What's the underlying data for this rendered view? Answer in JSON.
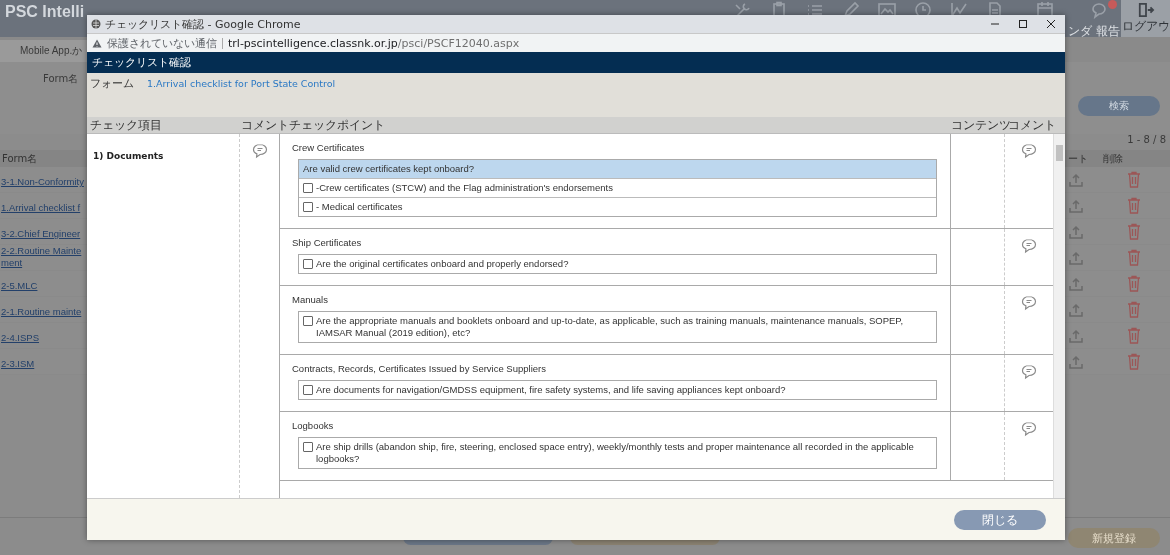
{
  "app_header": {
    "title": "PSC Intelli",
    "calendar_label": "ンダ",
    "report_label": "報告",
    "logout_label": "ログアウ"
  },
  "background_page": {
    "tab": "Mobile App.か",
    "form_label": "Form名",
    "search_button": "検索",
    "count": "1 - 8 / 8",
    "columns": [
      "Form名",
      "ート",
      "削除"
    ],
    "rows": [
      {
        "name": "3-1.Non-Conformity"
      },
      {
        "name": "1.Arrival checklist f"
      },
      {
        "name": "3-2.Chief Engineer"
      },
      {
        "name": "2-2.Routine Mainte\nment"
      },
      {
        "name": "2-5.MLC"
      },
      {
        "name": "2-1.Routine mainte"
      },
      {
        "name": "2-4.ISPS"
      },
      {
        "name": "2-3.ISM"
      }
    ],
    "new_button": "新規登録"
  },
  "browser_window": {
    "title": "チェックリスト確認 - Google Chrome",
    "security": "保護されていない通信",
    "url_host": "trl-pscintelligence.classnk.or.jp",
    "url_path": "/psci/PSCF12040.aspx"
  },
  "dialog": {
    "title": "チェックリスト確認",
    "form_label": "フォーム",
    "form_name": "1.Arrival checklist for Port State Control",
    "columns": [
      "チェック項目",
      "コメント",
      "チェックポイント",
      "コンテンツ",
      "コメント"
    ],
    "items": [
      {
        "label": "1) Documents",
        "sections": [
          {
            "title": "Crew Certificates",
            "points": [
              {
                "kind": "question",
                "text": "Are valid crew certificates kept onboard?"
              },
              {
                "kind": "check",
                "text": "-Crew certificates (STCW) and the Flag administration's endorsements",
                "checked": false
              },
              {
                "kind": "check",
                "text": "- Medical certificates",
                "checked": false
              }
            ]
          },
          {
            "title": "Ship Certificates",
            "points": [
              {
                "kind": "check",
                "text": "Are the original certificates onboard and properly endorsed?",
                "checked": false
              }
            ]
          },
          {
            "title": "Manuals",
            "points": [
              {
                "kind": "check",
                "text": "Are the appropriate manuals and booklets onboard and up-to-date, as applicable, such as training manuals, maintenance manuals, SOPEP, IAMSAR Manual (2019 edition), etc?",
                "checked": false
              }
            ]
          },
          {
            "title": "Contracts, Records, Certificates Issued by Service Suppliers",
            "points": [
              {
                "kind": "check",
                "text": "Are documents for navigation/GMDSS equipment, fire safety systems, and life saving appliances kept onboard?",
                "checked": false
              }
            ]
          },
          {
            "title": "Logbooks",
            "points": [
              {
                "kind": "check",
                "text": "Are ship drills (abandon ship, fire, steering, enclosed space entry), weekly/monthly tests and proper maintenance all recorded in the applicable logbooks?",
                "checked": false
              }
            ]
          }
        ]
      }
    ],
    "close_button": "閉じる"
  }
}
